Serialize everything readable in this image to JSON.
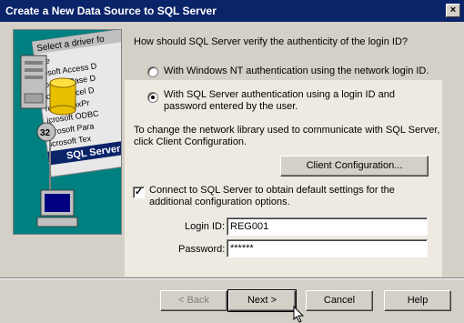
{
  "window": {
    "title": "Create a New Data Source to SQL Server",
    "close_glyph": "×"
  },
  "illustration": {
    "header": "Select a driver fo",
    "drivers": [
      "me",
      "rosoft Access D",
      "rosoft dBase D",
      "rosoft Excel D",
      "rosoft FoxPr",
      "icrosoft ODBC",
      "icrosoft Para",
      "icrosoft Tex"
    ],
    "selected": "SQL Server",
    "badge": "32"
  },
  "auth": {
    "question": "How should SQL Server verify the authenticity of the login ID?",
    "option_nt": "With Windows NT authentication using the network login ID.",
    "option_sql": "With SQL Server authentication using a login ID and password entered by the user.",
    "selected": "sql"
  },
  "network": {
    "text": "To change the network library used to communicate with SQL Server, click Client Configuration.",
    "client_config_button": "Client Configuration..."
  },
  "connect": {
    "checkbox_label": "Connect to SQL Server to obtain default settings for the additional configuration options.",
    "checked": true,
    "check_glyph": "✓"
  },
  "login": {
    "login_id_label": "Login ID:",
    "login_id_value": "REG001",
    "password_label": "Password:",
    "password_value": "******"
  },
  "buttons": {
    "back": "< Back",
    "next": "Next >",
    "cancel": "Cancel",
    "help": "Help"
  }
}
